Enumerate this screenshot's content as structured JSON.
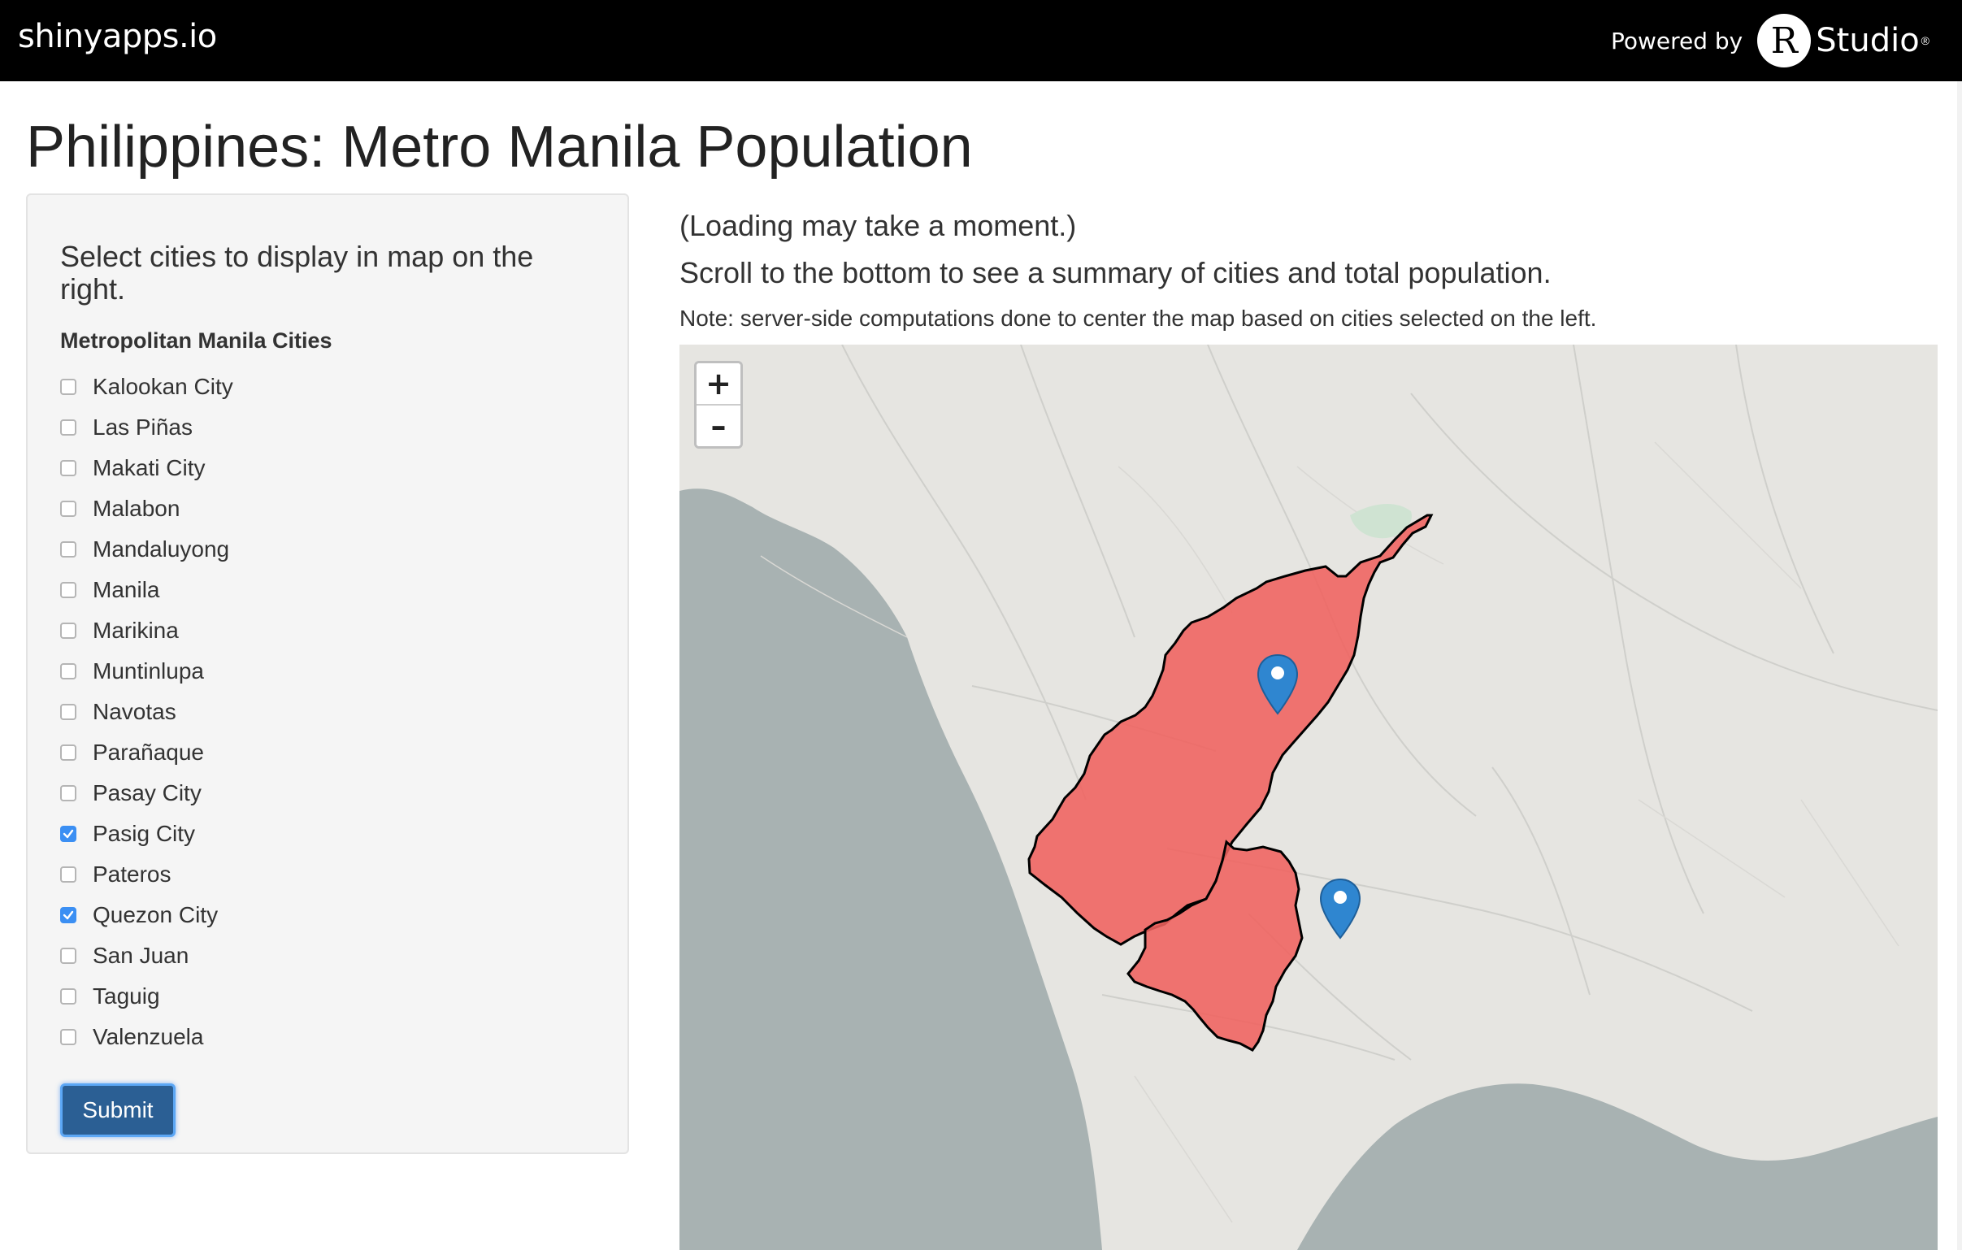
{
  "app": {
    "brand": "shinyapps.io",
    "powered_by": "Powered by",
    "r_logo": "R",
    "studio": "Studio",
    "registered": "®"
  },
  "page": {
    "title": "Philippines: Metro Manila Population"
  },
  "sidebar": {
    "heading": "Select cities to display in map on the right.",
    "group_label": "Metropolitan Manila Cities",
    "cities": [
      {
        "label": "Kalookan City",
        "checked": false
      },
      {
        "label": "Las Piñas",
        "checked": false
      },
      {
        "label": "Makati City",
        "checked": false
      },
      {
        "label": "Malabon",
        "checked": false
      },
      {
        "label": "Mandaluyong",
        "checked": false
      },
      {
        "label": "Manila",
        "checked": false
      },
      {
        "label": "Marikina",
        "checked": false
      },
      {
        "label": "Muntinlupa",
        "checked": false
      },
      {
        "label": "Navotas",
        "checked": false
      },
      {
        "label": "Parañaque",
        "checked": false
      },
      {
        "label": "Pasay City",
        "checked": false
      },
      {
        "label": "Pasig City",
        "checked": true
      },
      {
        "label": "Pateros",
        "checked": false
      },
      {
        "label": "Quezon City",
        "checked": true
      },
      {
        "label": "San Juan",
        "checked": false
      },
      {
        "label": "Taguig",
        "checked": false
      },
      {
        "label": "Valenzuela",
        "checked": false
      }
    ],
    "submit_label": "Submit"
  },
  "main": {
    "loading_note": "(Loading may take a moment.)",
    "scroll_note": "Scroll to the bottom to see a summary of cities and total population.",
    "server_note": "Note: server-side computations done to center the map based on cities selected on the left."
  },
  "map": {
    "zoom_in": "+",
    "zoom_out": "–",
    "highlight_color": "#f0625f",
    "marker_color": "#2f86d0"
  },
  "colors": {
    "topbar": "#000000",
    "button": "#2b5f94",
    "checkbox_checked": "#3b8ff3",
    "water": "#a8b2b2",
    "land": "#e6e5e1"
  }
}
